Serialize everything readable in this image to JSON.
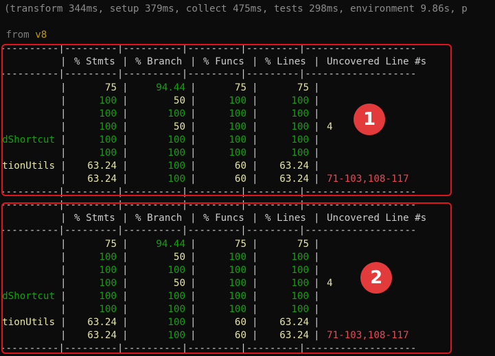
{
  "header": {
    "timing": "(transform 344ms, setup 379ms, collect 475ms, tests 298ms, environment 9.86s, p",
    "coverage_prefix": " from ",
    "coverage_provider": "v8"
  },
  "table_rule": "----------|---------|----------|---------|---------|-------------------",
  "headers": {
    "stmts": "% Stmts",
    "branch": "% Branch",
    "funcs": "% Funcs",
    "lines": "% Lines",
    "uncovered": "Uncovered Line #s"
  },
  "colors": {
    "high": "#13a10e",
    "medium": "#e5e5a0",
    "low": "#e74856",
    "highlight_box": "#e0141e",
    "badge": "#e33b3b"
  },
  "tables": [
    {
      "badge": "1",
      "rows": [
        {
          "file": "",
          "file_color": "white",
          "stmts": "75",
          "stmts_color": "yellow",
          "branch": "94.44",
          "branch_color": "green",
          "funcs": "75",
          "funcs_color": "yellow",
          "lines": "75",
          "lines_color": "yellow",
          "uncovered": "",
          "uncovered_color": "white"
        },
        {
          "file": "",
          "file_color": "white",
          "stmts": "100",
          "stmts_color": "green",
          "branch": "50",
          "branch_color": "yellow",
          "funcs": "100",
          "funcs_color": "green",
          "lines": "100",
          "lines_color": "green",
          "uncovered": "",
          "uncovered_color": "white"
        },
        {
          "file": "",
          "file_color": "white",
          "stmts": "100",
          "stmts_color": "green",
          "branch": "100",
          "branch_color": "green",
          "funcs": "100",
          "funcs_color": "green",
          "lines": "100",
          "lines_color": "green",
          "uncovered": "",
          "uncovered_color": "white"
        },
        {
          "file": "",
          "file_color": "white",
          "stmts": "100",
          "stmts_color": "green",
          "branch": "50",
          "branch_color": "yellow",
          "funcs": "100",
          "funcs_color": "green",
          "lines": "100",
          "lines_color": "green",
          "uncovered": "4",
          "uncovered_color": "yellow"
        },
        {
          "file": "dShortcut",
          "file_color": "green",
          "stmts": "100",
          "stmts_color": "green",
          "branch": "100",
          "branch_color": "green",
          "funcs": "100",
          "funcs_color": "green",
          "lines": "100",
          "lines_color": "green",
          "uncovered": "",
          "uncovered_color": "white"
        },
        {
          "file": "",
          "file_color": "white",
          "stmts": "100",
          "stmts_color": "green",
          "branch": "100",
          "branch_color": "green",
          "funcs": "100",
          "funcs_color": "green",
          "lines": "100",
          "lines_color": "green",
          "uncovered": "",
          "uncovered_color": "white"
        },
        {
          "file": "tionUtils",
          "file_color": "yellow",
          "stmts": "63.24",
          "stmts_color": "yellow",
          "branch": "100",
          "branch_color": "green",
          "funcs": "60",
          "funcs_color": "yellow",
          "lines": "63.24",
          "lines_color": "yellow",
          "uncovered": "",
          "uncovered_color": "white"
        },
        {
          "file": "",
          "file_color": "white",
          "stmts": "63.24",
          "stmts_color": "yellow",
          "branch": "100",
          "branch_color": "green",
          "funcs": "60",
          "funcs_color": "yellow",
          "lines": "63.24",
          "lines_color": "yellow",
          "uncovered": "71-103,108-117",
          "uncovered_color": "red"
        }
      ]
    },
    {
      "badge": "2",
      "rows": [
        {
          "file": "",
          "file_color": "white",
          "stmts": "75",
          "stmts_color": "yellow",
          "branch": "94.44",
          "branch_color": "green",
          "funcs": "75",
          "funcs_color": "yellow",
          "lines": "75",
          "lines_color": "yellow",
          "uncovered": "",
          "uncovered_color": "white"
        },
        {
          "file": "",
          "file_color": "white",
          "stmts": "100",
          "stmts_color": "green",
          "branch": "50",
          "branch_color": "yellow",
          "funcs": "100",
          "funcs_color": "green",
          "lines": "100",
          "lines_color": "green",
          "uncovered": "",
          "uncovered_color": "white"
        },
        {
          "file": "",
          "file_color": "white",
          "stmts": "100",
          "stmts_color": "green",
          "branch": "100",
          "branch_color": "green",
          "funcs": "100",
          "funcs_color": "green",
          "lines": "100",
          "lines_color": "green",
          "uncovered": "",
          "uncovered_color": "white"
        },
        {
          "file": "",
          "file_color": "white",
          "stmts": "100",
          "stmts_color": "green",
          "branch": "50",
          "branch_color": "yellow",
          "funcs": "100",
          "funcs_color": "green",
          "lines": "100",
          "lines_color": "green",
          "uncovered": "4",
          "uncovered_color": "yellow"
        },
        {
          "file": "dShortcut",
          "file_color": "green",
          "stmts": "100",
          "stmts_color": "green",
          "branch": "100",
          "branch_color": "green",
          "funcs": "100",
          "funcs_color": "green",
          "lines": "100",
          "lines_color": "green",
          "uncovered": "",
          "uncovered_color": "white"
        },
        {
          "file": "",
          "file_color": "white",
          "stmts": "100",
          "stmts_color": "green",
          "branch": "100",
          "branch_color": "green",
          "funcs": "100",
          "funcs_color": "green",
          "lines": "100",
          "lines_color": "green",
          "uncovered": "",
          "uncovered_color": "white"
        },
        {
          "file": "tionUtils",
          "file_color": "yellow",
          "stmts": "63.24",
          "stmts_color": "yellow",
          "branch": "100",
          "branch_color": "green",
          "funcs": "60",
          "funcs_color": "yellow",
          "lines": "63.24",
          "lines_color": "yellow",
          "uncovered": "",
          "uncovered_color": "white"
        },
        {
          "file": "",
          "file_color": "white",
          "stmts": "63.24",
          "stmts_color": "yellow",
          "branch": "100",
          "branch_color": "green",
          "funcs": "60",
          "funcs_color": "yellow",
          "lines": "63.24",
          "lines_color": "yellow",
          "uncovered": "71-103,108-117",
          "uncovered_color": "red"
        }
      ]
    }
  ]
}
